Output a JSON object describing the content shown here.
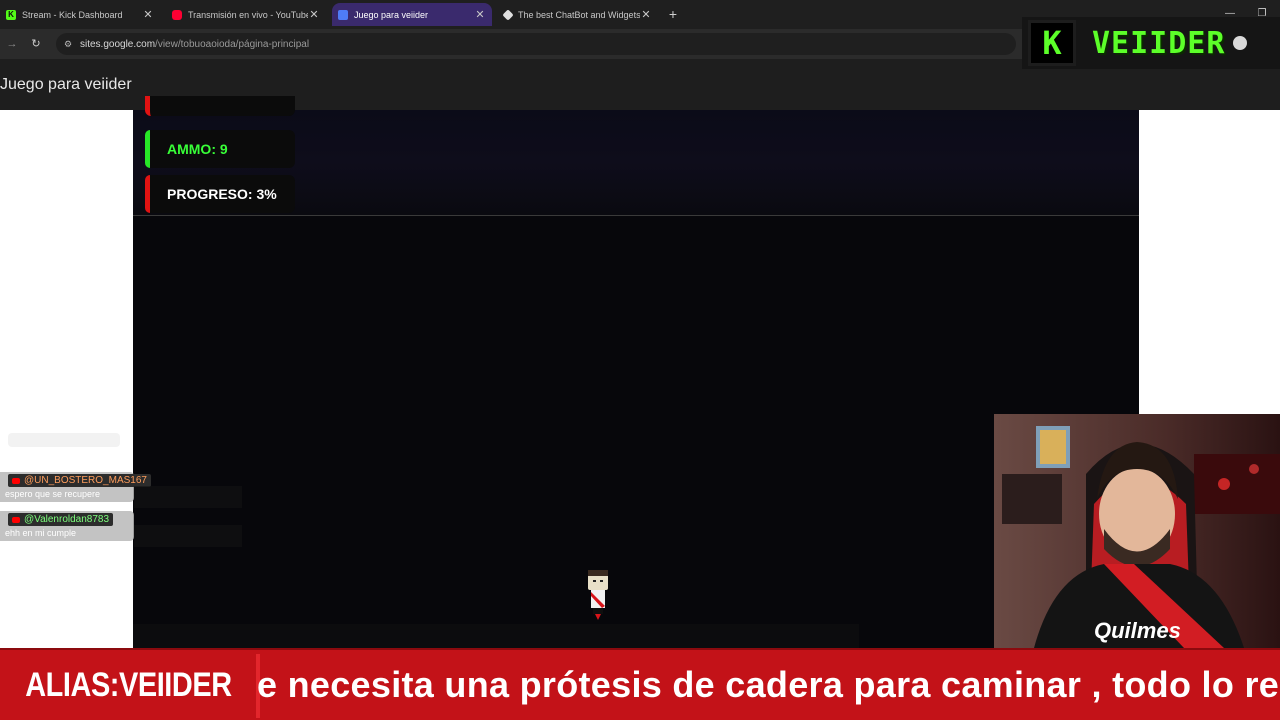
{
  "browser": {
    "tabs": [
      {
        "title": "Stream - Kick Dashboard",
        "favicon": "kick-icon",
        "color": "#53fc18",
        "active": false
      },
      {
        "title": "Transmisión en vivo - YouTube",
        "favicon": "youtube-icon",
        "color": "#ff0033",
        "active": false
      },
      {
        "title": "Juego para veiider",
        "favicon": "google-sites-icon",
        "color": "#4f7cf6",
        "active": true
      },
      {
        "title": "The best ChatBot and Widgets",
        "favicon": "chatbot-icon",
        "color": "#e0e0e0",
        "active": false
      }
    ],
    "url_host": "sites.google.com",
    "url_path": "/view/tobuoaoioda/página-principal"
  },
  "overlay": {
    "logo_letter": "K",
    "logo_text": "VEIIDER",
    "accent": "#5cff29"
  },
  "site": {
    "title": "Juego para veiider"
  },
  "game": {
    "hud": {
      "ammo": "AMMO: 9",
      "progress": "PROGRESO: 3%",
      "progress_value": 3
    }
  },
  "chat": {
    "messages": [
      {
        "user": "@UN_BOSTERO_MAS167",
        "user_color": "#ff9d5c",
        "text": "espero que se recupere"
      },
      {
        "user": "@Valenroldan8783",
        "user_color": "#7dff7d",
        "text": "ehh en mi cumple"
      }
    ]
  },
  "banner": {
    "alias": "ALIAS:VEIIDER",
    "ticker": "e necesita una prótesis de cadera para caminar , todo lo re",
    "color": "#c31218"
  }
}
